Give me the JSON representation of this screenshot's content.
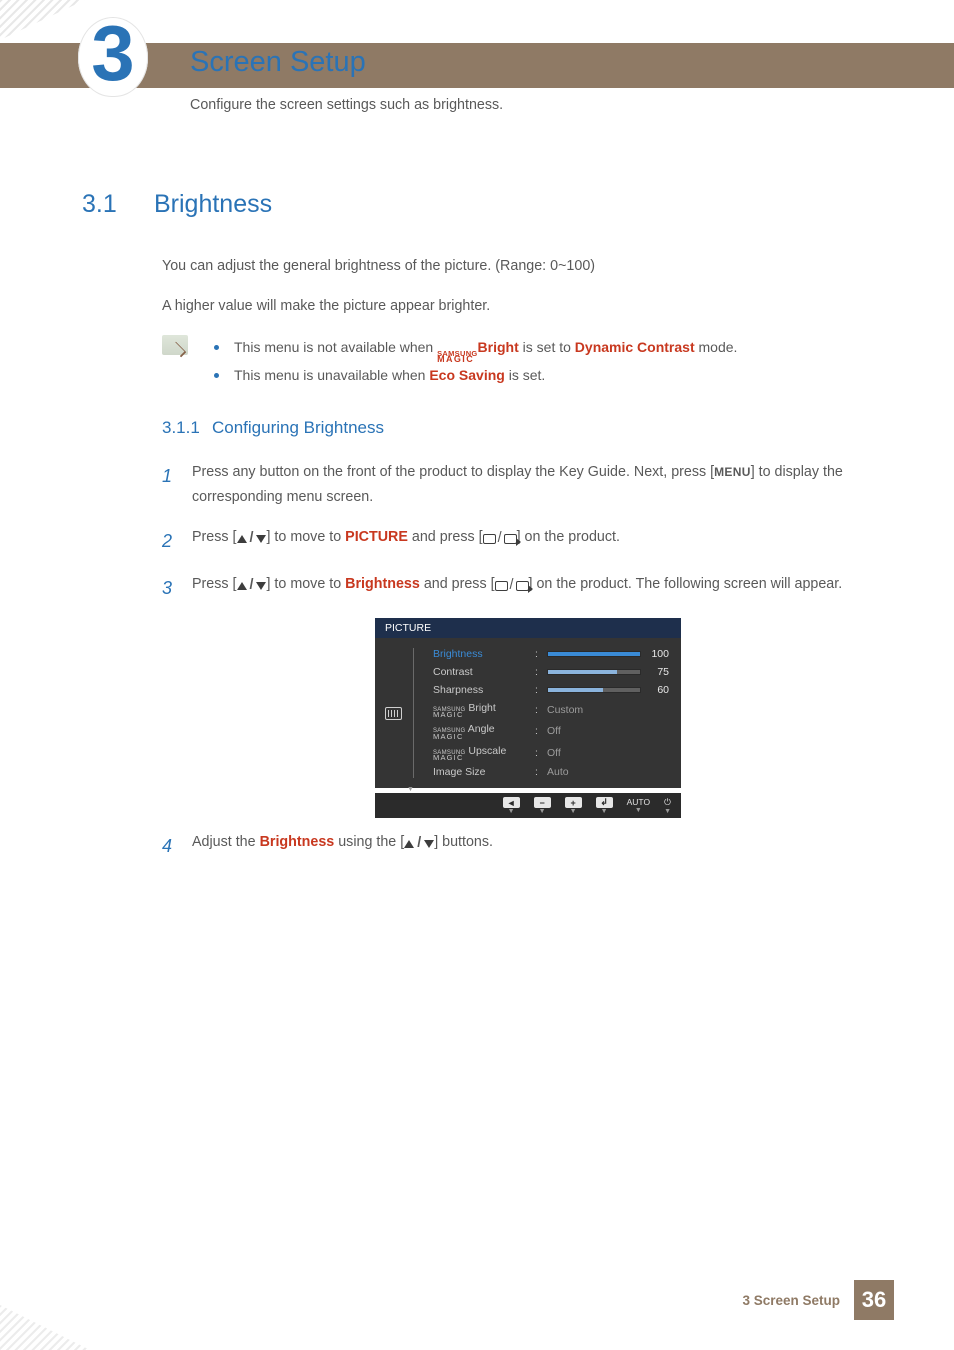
{
  "chapter": {
    "number": "3",
    "title": "Screen Setup",
    "subtext": "Configure the screen settings such as brightness."
  },
  "section": {
    "number": "3.1",
    "title": "Brightness",
    "intro1": "You can adjust the general brightness of the picture. (Range: 0~100)",
    "intro2": "A higher value will make the picture appear brighter."
  },
  "notes": {
    "item1_pre": "This menu is not available when ",
    "item1_brand": "Bright",
    "item1_mid": " is set to ",
    "item1_link": "Dynamic Contrast",
    "item1_post": " mode.",
    "item2_pre": "This menu is unavailable when ",
    "item2_link": "Eco Saving",
    "item2_post": " is set."
  },
  "subsection": {
    "number": "3.1.1",
    "title": "Configuring Brightness"
  },
  "steps": {
    "s1a": "Press any button on the front of the product to display the Key Guide. Next, press [",
    "s1menu": "MENU",
    "s1b": "] to display the corresponding menu screen.",
    "s2a": "Press [",
    "s2b": "] to move to ",
    "s2_picture": "PICTURE",
    "s2c": " and press [",
    "s2d": "] on the product.",
    "s3a": "Press [",
    "s3b": "] to move to ",
    "s3_bright": "Brightness",
    "s3c": " and press [",
    "s3d": "] on the product. The following screen will appear.",
    "s4a": "Adjust the ",
    "s4_bright": "Brightness",
    "s4b": " using the [",
    "s4c": "] buttons."
  },
  "osd": {
    "title": "PICTURE",
    "rows": [
      {
        "label": "Brightness",
        "type": "bar",
        "value": 100,
        "max": 100,
        "selected": true
      },
      {
        "label": "Contrast",
        "type": "bar",
        "value": 75,
        "max": 100
      },
      {
        "label": "Sharpness",
        "type": "bar",
        "value": 60,
        "max": 100
      },
      {
        "labelBrand": "Bright",
        "type": "text",
        "text": "Custom"
      },
      {
        "labelBrand": "Angle",
        "type": "text",
        "text": "Off"
      },
      {
        "labelBrand": "Upscale",
        "type": "text",
        "text": "Off"
      },
      {
        "label": "Image Size",
        "type": "text",
        "text": "Auto"
      }
    ],
    "footer": {
      "auto": "AUTO"
    }
  },
  "magic": {
    "line1": "SAMSUNG",
    "line2": "MAGIC"
  },
  "footer": {
    "label": "3 Screen Setup",
    "page": "36"
  }
}
